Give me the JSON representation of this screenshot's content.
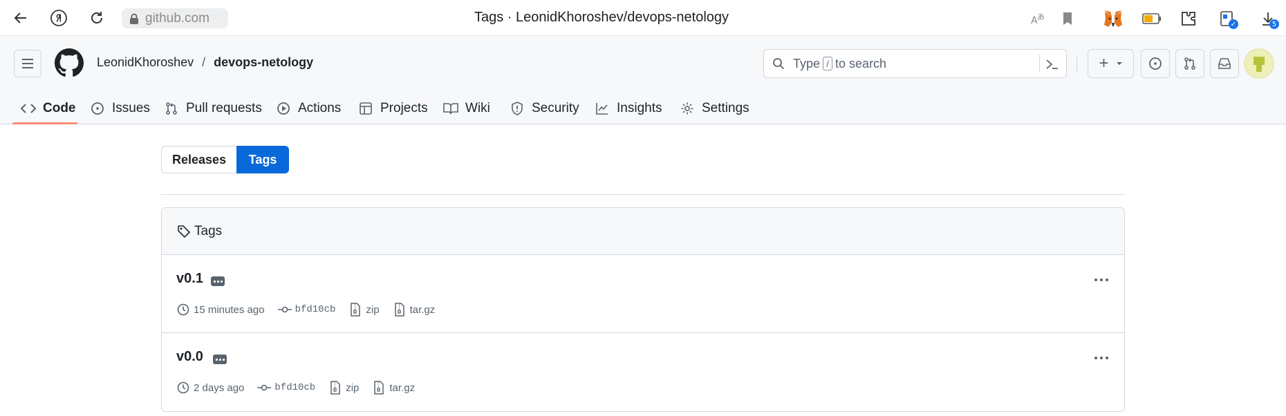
{
  "browser": {
    "url": "github.com",
    "title": "Tags · LeonidKhoroshev/devops-netology",
    "downloads_badge": "5"
  },
  "header": {
    "owner": "LeonidKhoroshev",
    "separator": "/",
    "repo": "devops-netology",
    "search": {
      "placeholder_before": "Type",
      "key": "/",
      "placeholder_after": "to search"
    },
    "plus": "+"
  },
  "nav": {
    "tabs": [
      {
        "label": "Code",
        "icon": "code-icon"
      },
      {
        "label": "Issues",
        "icon": "issue-icon"
      },
      {
        "label": "Pull requests",
        "icon": "pull-request-icon"
      },
      {
        "label": "Actions",
        "icon": "play-icon"
      },
      {
        "label": "Projects",
        "icon": "table-icon"
      },
      {
        "label": "Wiki",
        "icon": "book-icon"
      },
      {
        "label": "Security",
        "icon": "shield-icon"
      },
      {
        "label": "Insights",
        "icon": "graph-icon"
      },
      {
        "label": "Settings",
        "icon": "gear-icon"
      }
    ],
    "active": "Code"
  },
  "segmented": {
    "releases": "Releases",
    "tags": "Tags"
  },
  "tags_box": {
    "title": "Tags",
    "items": [
      {
        "name": "v0.1",
        "time": "15 minutes ago",
        "sha": "bfd10cb",
        "zip": "zip",
        "targz": "tar.gz"
      },
      {
        "name": "v0.0",
        "time": "2 days ago",
        "sha": "bfd10cb",
        "zip": "zip",
        "targz": "tar.gz"
      }
    ]
  },
  "colors": {
    "accent": "#0969da",
    "active_underline": "#fd8c73",
    "header_bg": "#f6f8fa",
    "border": "#d0d7de"
  }
}
